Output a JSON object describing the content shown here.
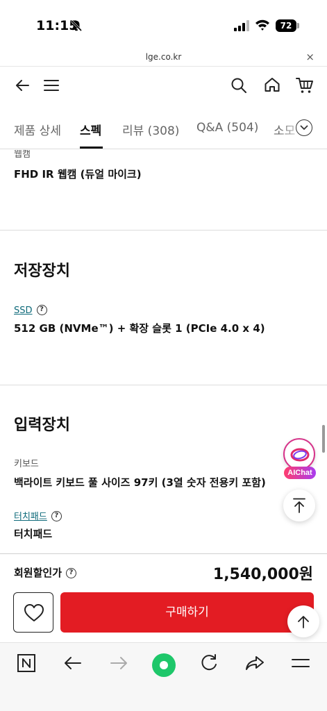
{
  "status_bar": {
    "time": "11:15",
    "battery": "72"
  },
  "url_bar": {
    "domain": "lge.co.kr",
    "close": "×"
  },
  "tabs": [
    {
      "label": "제품 상세"
    },
    {
      "label": "스펙"
    },
    {
      "label": "리뷰 (308)"
    },
    {
      "label": "Q&A (504)"
    },
    {
      "label": "소모"
    }
  ],
  "specs": {
    "webcam_label": "웹캠",
    "webcam_value": "FHD IR 웹캠 (듀얼 마이크)",
    "storage_title": "저장장치",
    "ssd_label": "SSD",
    "ssd_value": "512 GB (NVMe™) + 확장 슬롯 1 (PCIe 4.0 x 4)",
    "input_title": "입력장치",
    "keyboard_label": "키보드",
    "keyboard_value": "백라이트 키보드 풀 사이즈 97키 (3열 숫자 전용키 포함)",
    "touchpad_label": "터치패드",
    "touchpad_value": "터치패드"
  },
  "help_glyph": "?",
  "aichat": {
    "label": "AIChat"
  },
  "price_bar": {
    "label": "회원할인가",
    "price": "1,540,000원",
    "buy_label": "구매하기"
  },
  "colors": {
    "accent_red": "#e31c23",
    "link_teal": "#0e6a7a",
    "toolbar_green": "#1ec76a"
  }
}
